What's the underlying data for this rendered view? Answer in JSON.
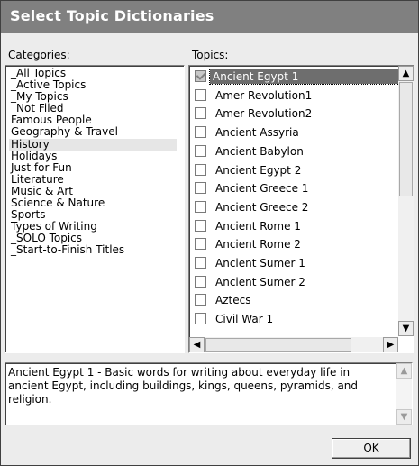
{
  "dialog": {
    "title": "Select Topic Dictionaries"
  },
  "categories": {
    "label": "Categories:",
    "items": [
      "_All Topics",
      "_Active Topics",
      "_My Topics",
      "_Not Filed",
      "Famous People",
      "Geography & Travel",
      "History",
      "Holidays",
      "Just for Fun",
      "Literature",
      "Music & Art",
      "Science & Nature",
      "Sports",
      "Types of Writing",
      "_SOLO Topics",
      "_Start-to-Finish Titles"
    ],
    "selected": "History"
  },
  "topics": {
    "label": "Topics:",
    "items": [
      {
        "label": "Ancient Egypt 1",
        "checked": true,
        "selected": true
      },
      {
        "label": "Amer Revolution1",
        "checked": false
      },
      {
        "label": "Amer Revolution2",
        "checked": false
      },
      {
        "label": "Ancient Assyria",
        "checked": false
      },
      {
        "label": "Ancient Babylon",
        "checked": false
      },
      {
        "label": "Ancient Egypt 2",
        "checked": false
      },
      {
        "label": "Ancient Greece 1",
        "checked": false
      },
      {
        "label": "Ancient Greece 2",
        "checked": false
      },
      {
        "label": "Ancient Rome 1",
        "checked": false
      },
      {
        "label": "Ancient Rome 2",
        "checked": false
      },
      {
        "label": "Ancient Sumer 1",
        "checked": false
      },
      {
        "label": "Ancient Sumer 2",
        "checked": false
      },
      {
        "label": "Aztecs",
        "checked": false
      },
      {
        "label": "Civil War 1",
        "checked": false
      }
    ]
  },
  "description": {
    "text": "Ancient Egypt 1 - Basic words for writing about everyday life in ancient Egypt, including buildings, kings, queens, pyramids, and religion."
  },
  "buttons": {
    "ok_label": "OK"
  },
  "icons": {
    "scroll_up": "▲",
    "scroll_down": "▼",
    "scroll_left": "◀",
    "scroll_right": "▶"
  }
}
